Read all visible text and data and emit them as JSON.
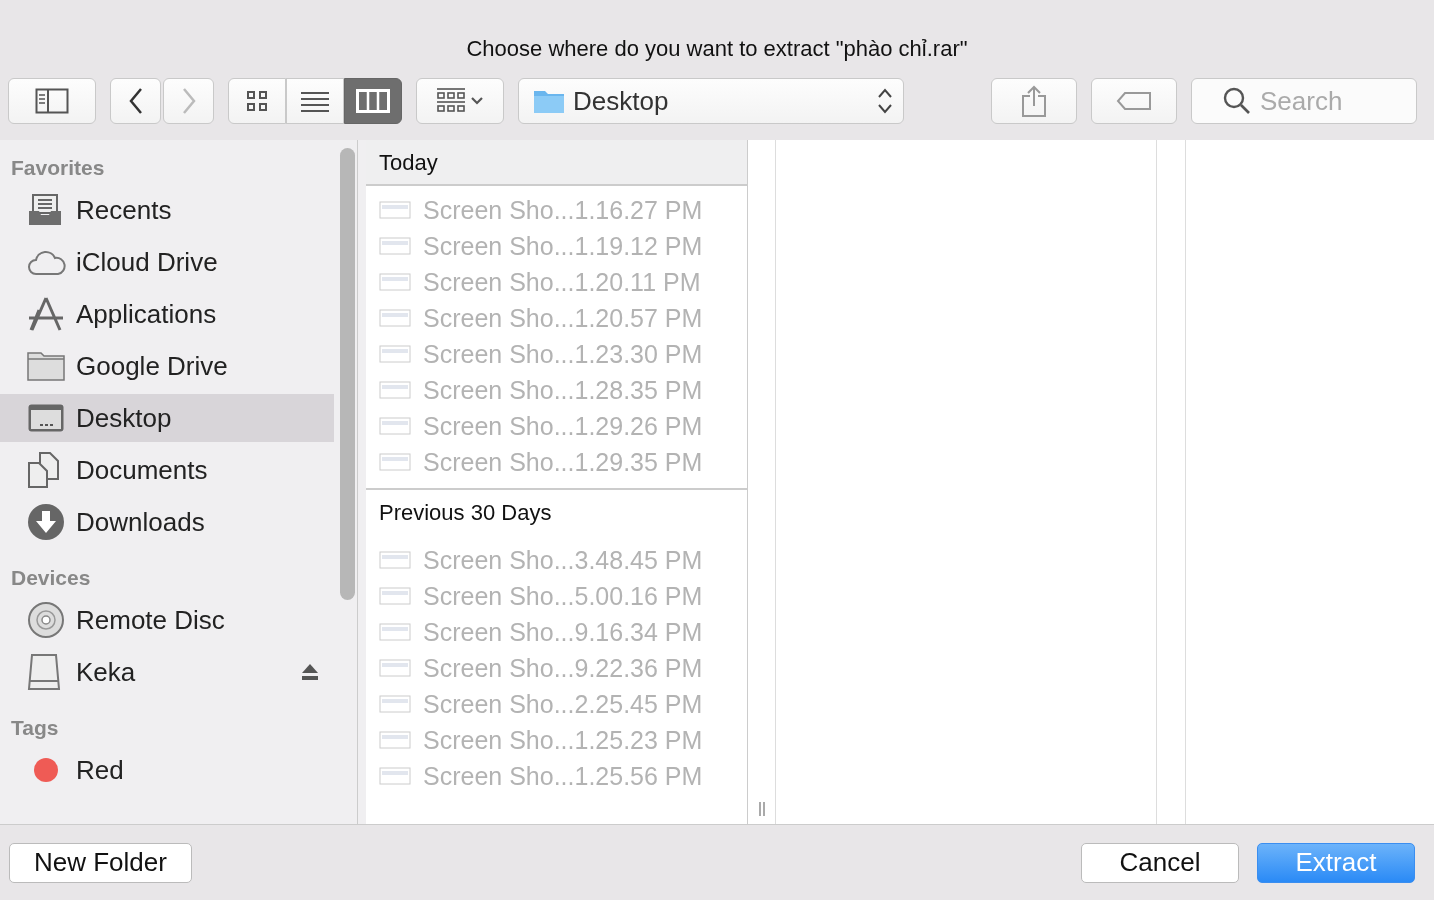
{
  "window": {
    "title": "Choose where do you want to extract \"phào chỉ.rar\""
  },
  "toolbar": {
    "back": {
      "disabled": false
    },
    "forward": {
      "disabled": true
    },
    "view_modes": [
      {
        "kind": "icons",
        "selected": false
      },
      {
        "kind": "list",
        "selected": false
      },
      {
        "kind": "columns",
        "selected": true
      }
    ],
    "location": "Desktop",
    "search": {
      "placeholder": "Search"
    }
  },
  "sidebar": [
    {
      "heading": "Favorites",
      "items": [
        {
          "kind": "recents",
          "label": "Recents",
          "selected": false
        },
        {
          "kind": "cloud",
          "label": "iCloud Drive",
          "selected": false
        },
        {
          "kind": "apps",
          "label": "Applications",
          "selected": false
        },
        {
          "kind": "folder",
          "label": "Google Drive",
          "selected": false
        },
        {
          "kind": "desktop",
          "label": "Desktop",
          "selected": true
        },
        {
          "kind": "documents",
          "label": "Documents",
          "selected": false
        },
        {
          "kind": "downloads",
          "label": "Downloads",
          "selected": false
        }
      ]
    },
    {
      "heading": "Devices",
      "items": [
        {
          "kind": "disc",
          "label": "Remote Disc",
          "selected": false,
          "ejectable": false
        },
        {
          "kind": "drive",
          "label": "Keka",
          "selected": false,
          "ejectable": true
        }
      ]
    },
    {
      "heading": "Tags",
      "items": [
        {
          "kind": "tag",
          "label": "Red",
          "selected": false,
          "color": "#ef5b55"
        }
      ]
    }
  ],
  "file_groups": [
    {
      "heading": "Today",
      "files": [
        {
          "name": "Screen Sho...1.16.27 PM",
          "disabled": true
        },
        {
          "name": "Screen Sho...1.19.12 PM",
          "disabled": true
        },
        {
          "name": "Screen Sho...1.20.11 PM",
          "disabled": true
        },
        {
          "name": "Screen Sho...1.20.57 PM",
          "disabled": true
        },
        {
          "name": "Screen Sho...1.23.30 PM",
          "disabled": true
        },
        {
          "name": "Screen Sho...1.28.35 PM",
          "disabled": true
        },
        {
          "name": "Screen Sho...1.29.26 PM",
          "disabled": true
        },
        {
          "name": "Screen Sho...1.29.35 PM",
          "disabled": true
        }
      ]
    },
    {
      "heading": "Previous 30 Days",
      "files": [
        {
          "name": "Screen Sho...3.48.45 PM",
          "disabled": true
        },
        {
          "name": "Screen Sho...5.00.16 PM",
          "disabled": true
        },
        {
          "name": "Screen Sho...9.16.34 PM",
          "disabled": true
        },
        {
          "name": "Screen Sho...9.22.36 PM",
          "disabled": true
        },
        {
          "name": "Screen Sho...2.25.45 PM",
          "disabled": true
        },
        {
          "name": "Screen Sho...1.25.23 PM",
          "disabled": true
        },
        {
          "name": "Screen Sho...1.25.56 PM",
          "disabled": true
        }
      ]
    }
  ],
  "buttons": [
    {
      "label": "New Folder",
      "kind": "normal"
    },
    {
      "label": "Cancel",
      "kind": "normal"
    },
    {
      "label": "Extract",
      "kind": "default"
    }
  ]
}
